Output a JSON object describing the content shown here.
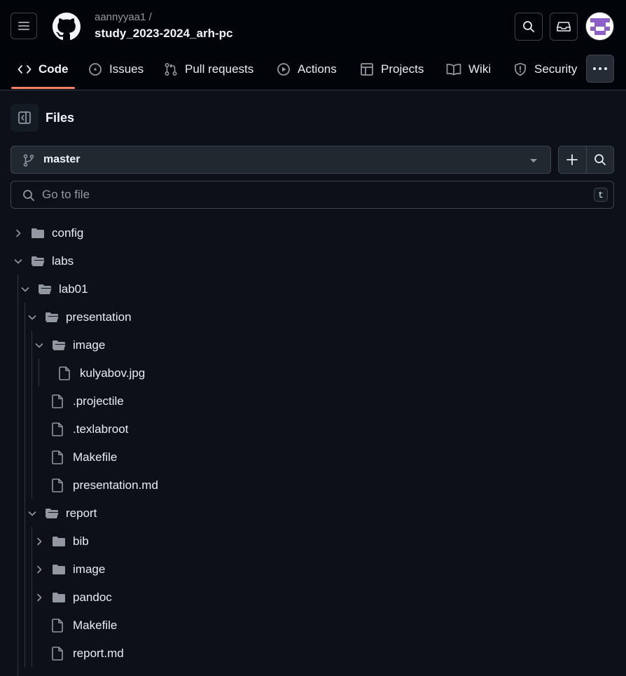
{
  "header": {
    "owner": "aannyyaa1 /",
    "repo": "study_2023-2024_arh-pc"
  },
  "tabs": [
    {
      "label": "Code",
      "icon": "code-icon"
    },
    {
      "label": "Issues",
      "icon": "issue-opened-icon"
    },
    {
      "label": "Pull requests",
      "icon": "git-pull-request-icon"
    },
    {
      "label": "Actions",
      "icon": "play-icon"
    },
    {
      "label": "Projects",
      "icon": "table-icon"
    },
    {
      "label": "Wiki",
      "icon": "book-icon"
    },
    {
      "label": "Security",
      "icon": "shield-icon"
    }
  ],
  "files_panel": {
    "title": "Files",
    "branch": "master",
    "search_placeholder": "Go to file",
    "shortcut_key": "t"
  },
  "tree": [
    {
      "name": "config",
      "type": "folder",
      "expanded": false
    },
    {
      "name": "labs",
      "type": "folder",
      "expanded": true
    },
    {
      "name": "lab01",
      "type": "folder",
      "expanded": true
    },
    {
      "name": "presentation",
      "type": "folder",
      "expanded": true
    },
    {
      "name": "image",
      "type": "folder",
      "expanded": true
    },
    {
      "name": "kulyabov.jpg",
      "type": "file"
    },
    {
      "name": ".projectile",
      "type": "file"
    },
    {
      "name": ".texlabroot",
      "type": "file"
    },
    {
      "name": "Makefile",
      "type": "file"
    },
    {
      "name": "presentation.md",
      "type": "file"
    },
    {
      "name": "report",
      "type": "folder",
      "expanded": true
    },
    {
      "name": "bib",
      "type": "folder",
      "expanded": false
    },
    {
      "name": "image",
      "type": "folder",
      "expanded": false
    },
    {
      "name": "pandoc",
      "type": "folder",
      "expanded": false
    },
    {
      "name": "Makefile",
      "type": "file"
    },
    {
      "name": "report.md",
      "type": "file"
    }
  ],
  "colors": {
    "background": "#0d1117",
    "header_background": "#010409",
    "active_tab_underline": "#f78166",
    "border": "#3d444d",
    "muted_text": "#9198a1",
    "icon": "#9198a1"
  }
}
